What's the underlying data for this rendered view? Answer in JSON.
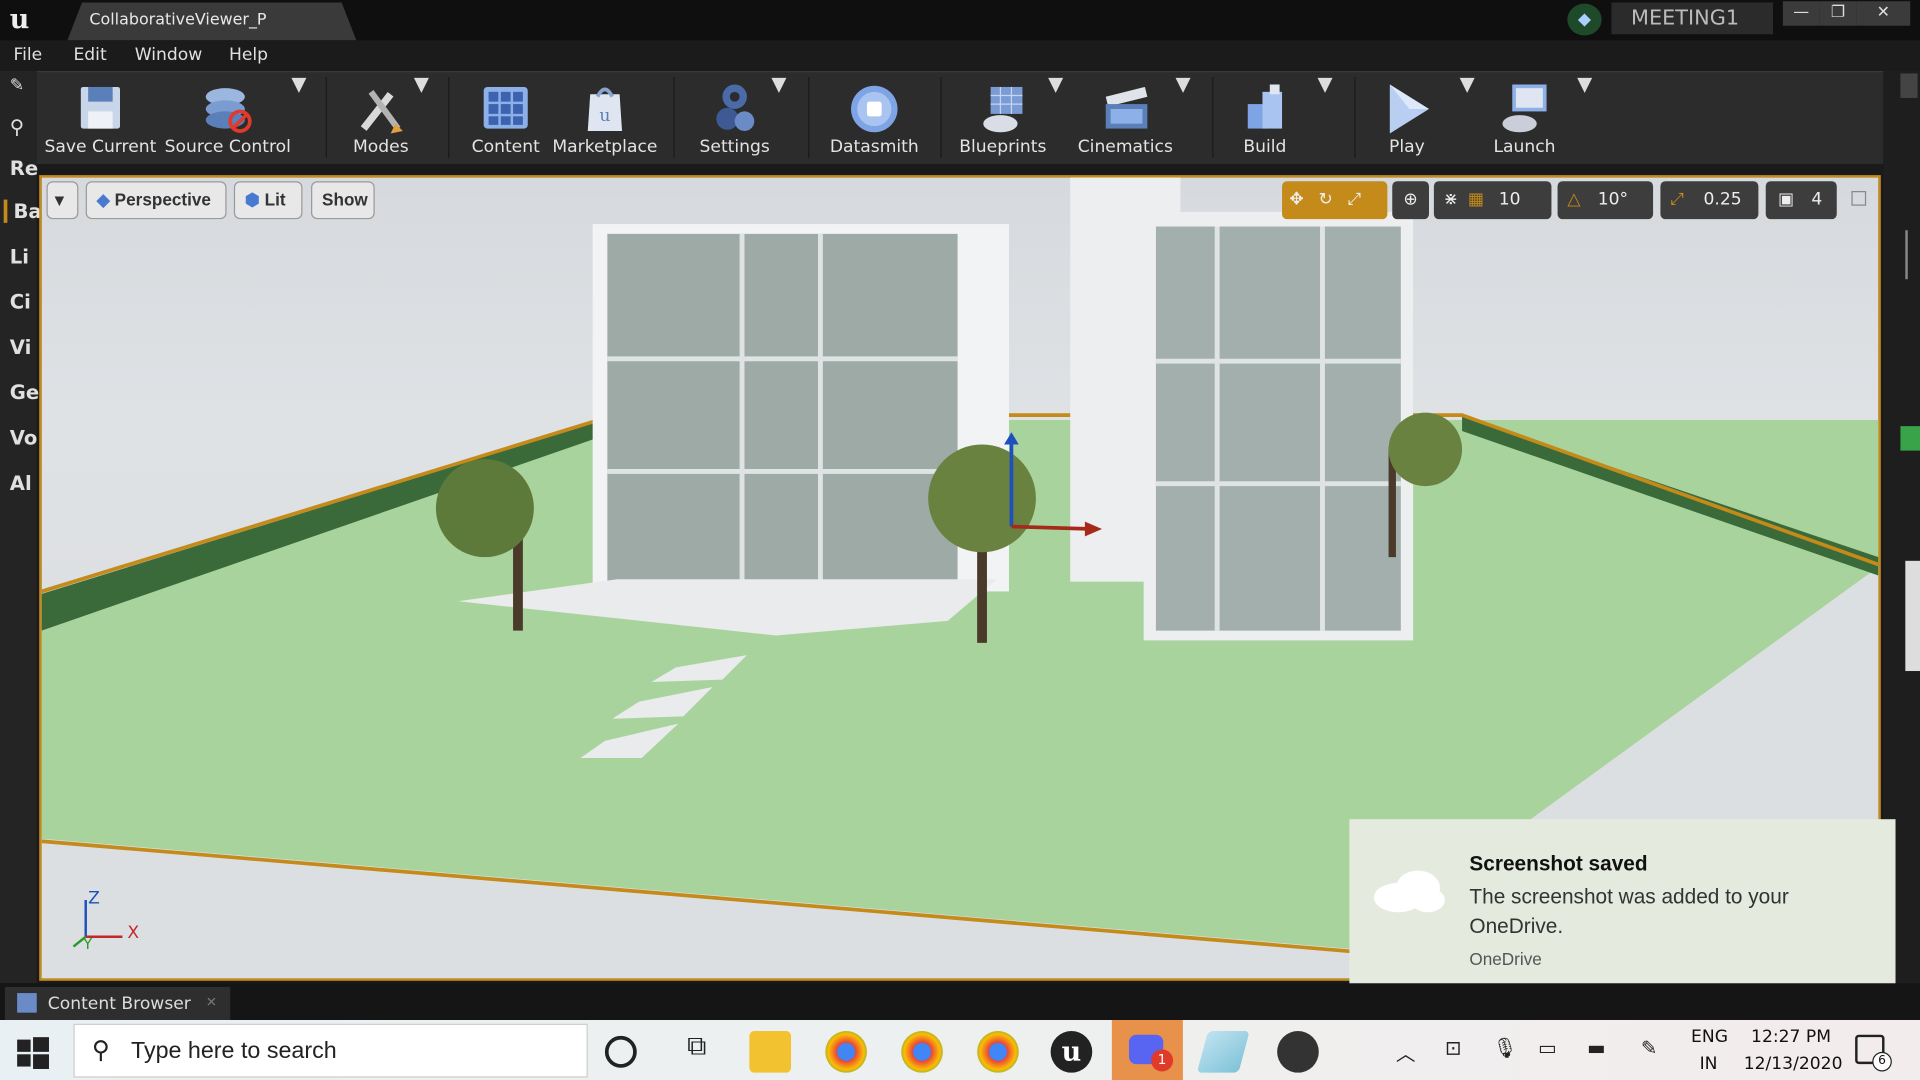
{
  "app": {
    "document_tab": "CollaborativeViewer_P",
    "session_name": "MEETING1"
  },
  "menu": [
    "File",
    "Edit",
    "Window",
    "Help"
  ],
  "toolbar": [
    {
      "label": "Save Current",
      "icon": "floppy-disk-icon"
    },
    {
      "label": "Source Control",
      "icon": "source-control-icon"
    },
    {
      "label": "Modes",
      "icon": "tools-icon"
    },
    {
      "label": "Content",
      "icon": "content-grid-icon"
    },
    {
      "label": "Marketplace",
      "icon": "marketplace-bag-icon"
    },
    {
      "label": "Settings",
      "icon": "gears-icon"
    },
    {
      "label": "Datasmith",
      "icon": "datasmith-icon"
    },
    {
      "label": "Blueprints",
      "icon": "blueprints-icon"
    },
    {
      "label": "Cinematics",
      "icon": "clapperboard-icon"
    },
    {
      "label": "Build",
      "icon": "build-blocks-icon"
    },
    {
      "label": "Play",
      "icon": "play-icon"
    },
    {
      "label": "Launch",
      "icon": "launch-icon"
    }
  ],
  "left_panel_tabs": [
    "Re",
    "Ba",
    "Li",
    "Ci",
    "Vi",
    "Ge",
    "Vo",
    "Al"
  ],
  "viewport": {
    "view_mode": "Perspective",
    "lighting": "Lit",
    "show_label": "Show",
    "grid_snap": "10",
    "rotation_snap": "10°",
    "scale_snap": "0.25",
    "camera_speed": "4",
    "axis_labels": {
      "z": "Z",
      "x": "X",
      "y": "Y"
    }
  },
  "content_browser": {
    "tab_label": "Content Browser"
  },
  "notification": {
    "title": "Screenshot saved",
    "body": "The screenshot was added to your OneDrive.",
    "source": "OneDrive"
  },
  "taskbar": {
    "search_placeholder": "Type here to search",
    "language_top": "ENG",
    "language_bottom": "IN",
    "time": "12:27 PM",
    "date": "12/13/2020",
    "notification_count": "6",
    "app_badge": "1"
  },
  "colors": {
    "selection_outline": "#c48a1a",
    "grass": "#a8d39a",
    "toast_bg": "#e4eadd"
  }
}
